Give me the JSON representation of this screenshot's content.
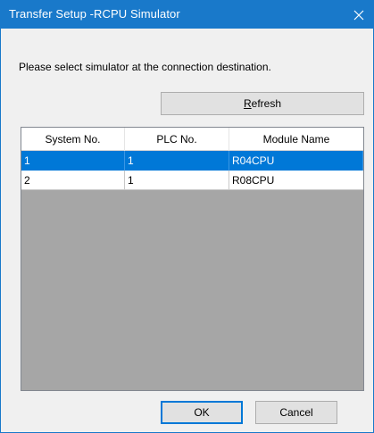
{
  "window": {
    "title": "Transfer Setup -RCPU Simulator",
    "close_glyph": "close-icon",
    "accent_color": "#1979ca"
  },
  "prompt": "Please select simulator at the connection destination.",
  "buttons": {
    "refresh_label_underlined": "R",
    "refresh_label_rest": "efresh",
    "ok_label": "OK",
    "cancel_label": "Cancel"
  },
  "table": {
    "columns": [
      "System No.",
      "PLC No.",
      "Module Name"
    ],
    "rows": [
      {
        "system_no": "1",
        "plc_no": "1",
        "module_name": "R04CPU",
        "selected": true
      },
      {
        "system_no": "2",
        "plc_no": "1",
        "module_name": "R08CPU",
        "selected": false
      }
    ],
    "selection_color": "#0078d7"
  }
}
